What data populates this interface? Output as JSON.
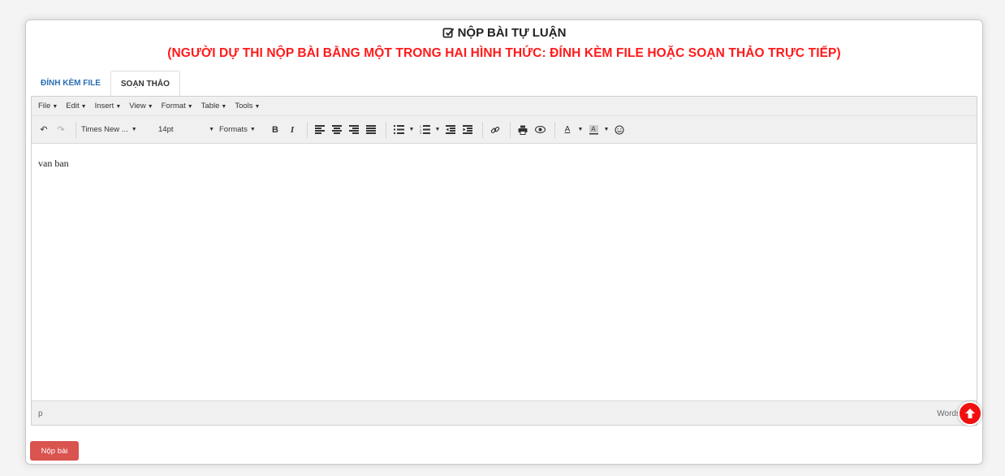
{
  "header": {
    "title": "NỘP BÀI TỰ LUẬN",
    "subtitle": "(NGƯỜI DỰ THI NỘP BÀI BẰNG MỘT TRONG HAI HÌNH THỨC: ĐÍNH KÈM FILE HOẶC SOẠN THẢO TRỰC TIẾP)"
  },
  "tabs": [
    {
      "label": "ĐÍNH KÈM FILE"
    },
    {
      "label": "SOẠN THẢO"
    }
  ],
  "menubar": [
    "File",
    "Edit",
    "Insert",
    "View",
    "Format",
    "Table",
    "Tools"
  ],
  "toolbar": {
    "font_family": "Times New ...",
    "font_size": "14pt",
    "formats": "Formats"
  },
  "editor": {
    "content": "van ban",
    "path": "p",
    "words_label": "Words"
  },
  "submit_label": "Nộp bài",
  "colors": {
    "accent_red": "#ff1a1a",
    "button_red": "#d9534f",
    "link_blue": "#2a6fb5"
  }
}
